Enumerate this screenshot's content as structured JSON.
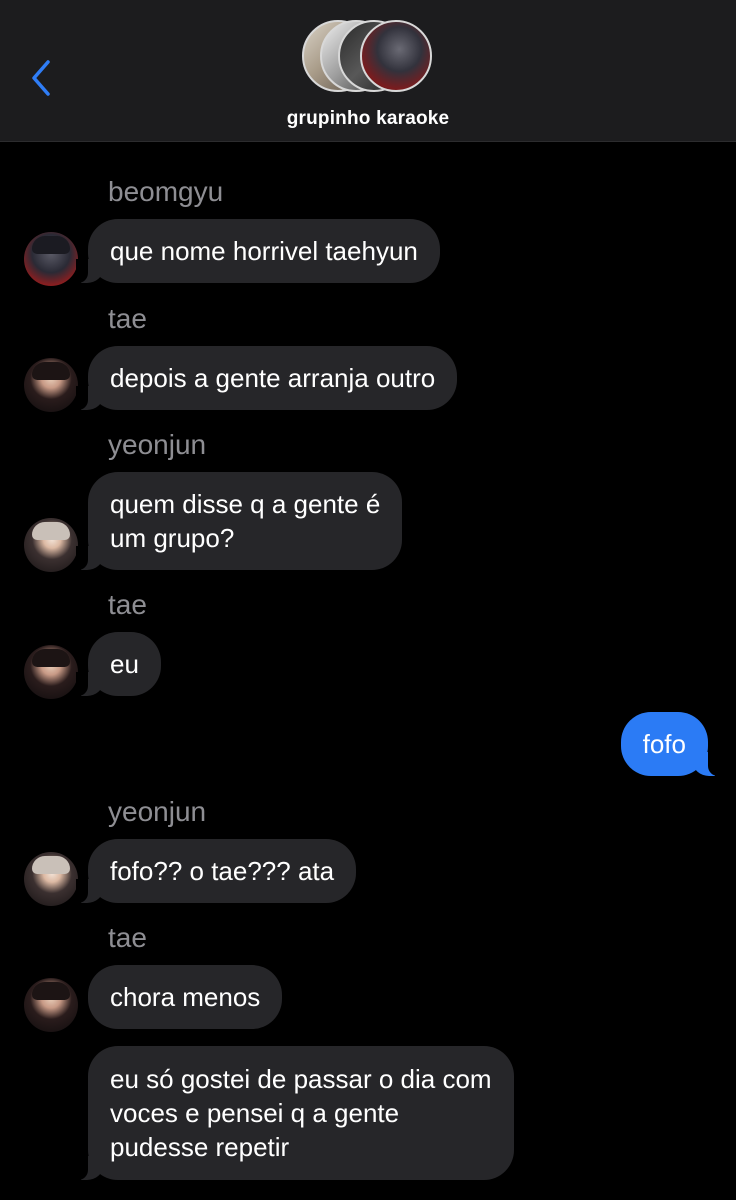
{
  "header": {
    "group_name": "grupinho karaoke"
  },
  "colors": {
    "background": "#000000",
    "header_bg": "#1c1c1e",
    "incoming_bubble": "#262629",
    "outgoing_bubble": "#2b7bf5",
    "sender_label": "#8e8e93",
    "back_icon": "#2f7df6"
  },
  "messages": [
    {
      "sender": "beomgyu",
      "text": "que nome horrivel taehyun",
      "direction": "incoming"
    },
    {
      "sender": "tae",
      "text": "depois a gente arranja outro",
      "direction": "incoming"
    },
    {
      "sender": "yeonjun",
      "lines": [
        "quem disse q a gente é",
        "um grupo?"
      ],
      "direction": "incoming"
    },
    {
      "sender": "tae",
      "text": "eu",
      "direction": "incoming"
    },
    {
      "text": "fofo",
      "direction": "outgoing"
    },
    {
      "sender": "yeonjun",
      "text": "fofo?? o tae??? ata",
      "direction": "incoming"
    },
    {
      "sender": "tae",
      "text": "chora menos",
      "direction": "incoming"
    },
    {
      "lines": [
        "eu só gostei de passar o dia com",
        "voces e pensei q a gente",
        "pudesse repetir"
      ],
      "direction": "incoming"
    }
  ]
}
